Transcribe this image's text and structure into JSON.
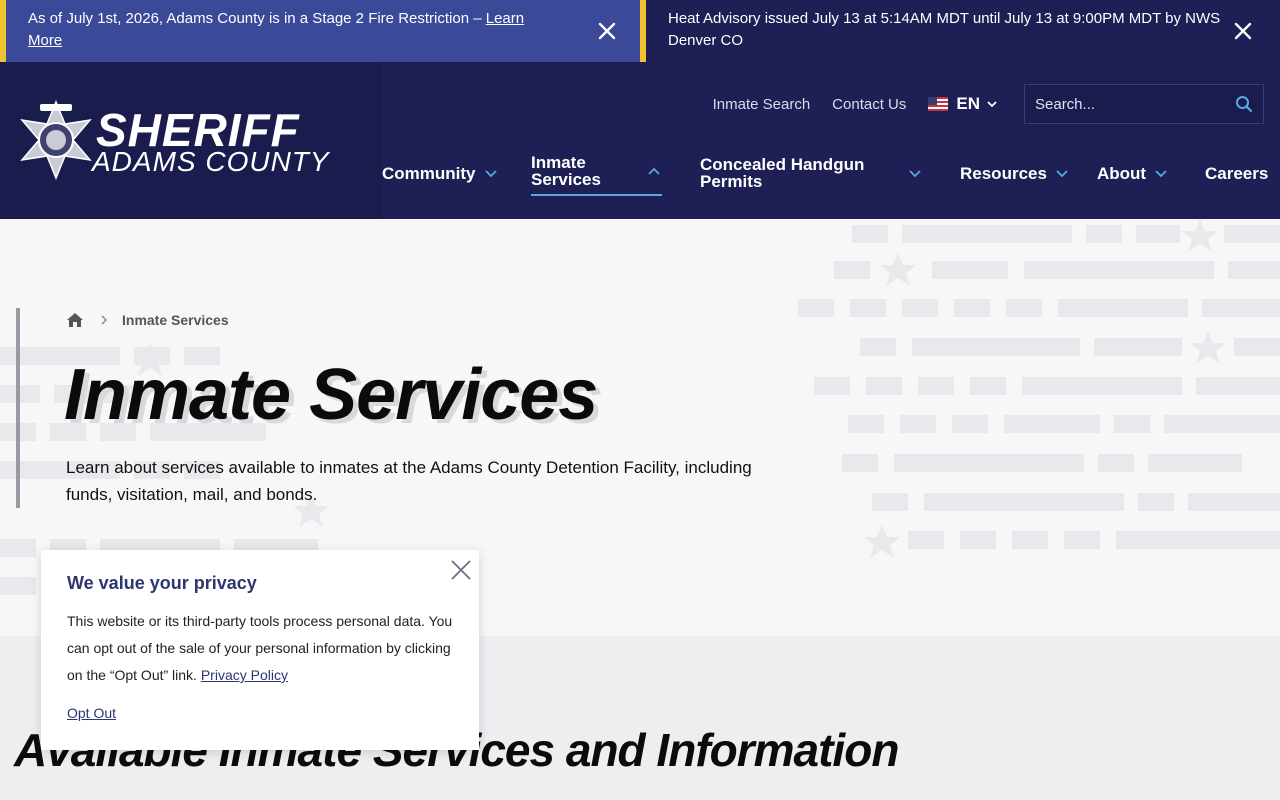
{
  "alerts": {
    "fire": {
      "text": "As of July 1st, 2026, Adams County is in a Stage 2 Fire Restriction – ",
      "link": "Learn More"
    },
    "heat": {
      "text": "Heat Advisory issued July 13 at 5:14AM MDT until July 13 at 9:00PM MDT by NWS Denver CO"
    }
  },
  "logo": {
    "line1": "SHERIFF",
    "line2": "ADAMS COUNTY"
  },
  "utility": {
    "links": [
      "Inmate Search",
      "Contact Us"
    ],
    "language": "EN",
    "search_placeholder": "Search..."
  },
  "nav": {
    "community": "Community",
    "inmate_services": "Inmate Services",
    "concealed_handgun": "Concealed Handgun Permits",
    "resources": "Resources",
    "about": "About",
    "careers": "Careers"
  },
  "breadcrumb": {
    "current": "Inmate Services"
  },
  "hero": {
    "title": "Inmate Services",
    "description": "Learn about services available to inmates at the Adams County Detention Facility, including funds, visitation, mail, and bonds."
  },
  "section": {
    "title": "Available Inmate Services and Information"
  },
  "privacy": {
    "title": "We value your privacy",
    "body": "This website or its third-party tools process personal data. You can opt out of the sale of your personal information by clicking on the “Opt Out” link. ",
    "policy_link": "Privacy Policy",
    "opt_out": "Opt Out"
  },
  "colors": {
    "navy": "#1e1f54",
    "fire_alert": "#3a4a99",
    "alert_border": "#f2c230",
    "accent_blue": "#5aa7e6"
  }
}
